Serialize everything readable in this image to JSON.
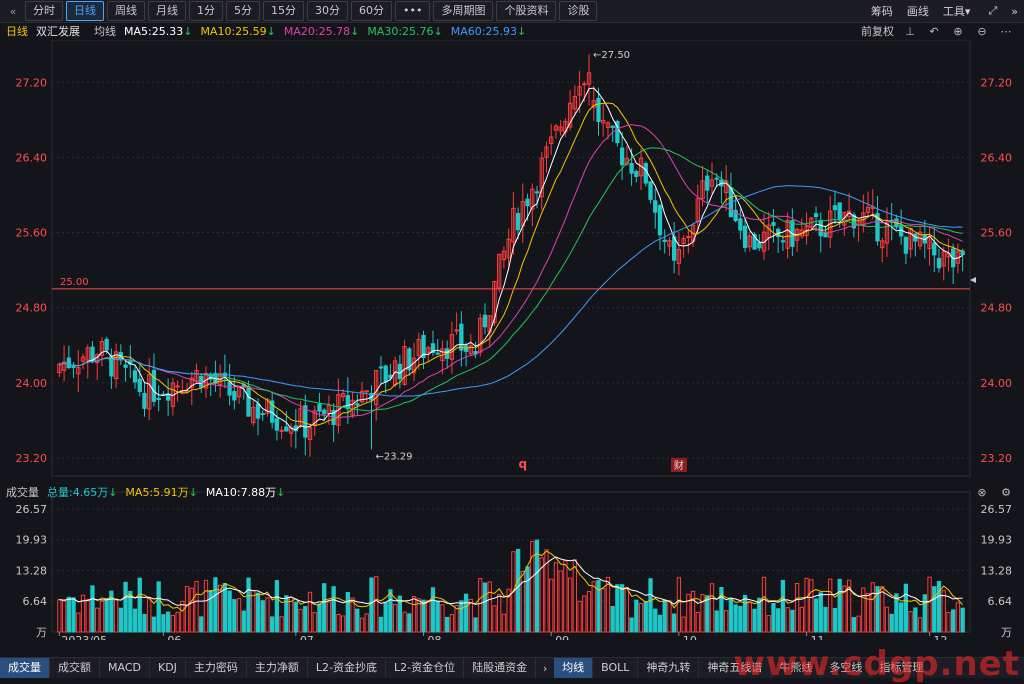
{
  "top_tabs": [
    "分时",
    "日线",
    "周线",
    "月线",
    "1分",
    "5分",
    "15分",
    "30分",
    "60分",
    "•••",
    "多周期图",
    "个股资料",
    "诊股"
  ],
  "active_tab": "日线",
  "top_right": [
    "筹码",
    "画线",
    "工具▾"
  ],
  "info": {
    "period": "日线",
    "name": "双汇发展",
    "indicator": "均线",
    "ma5": "MA5:25.33",
    "ma10": "MA10:25.59",
    "ma20": "MA20:25.78",
    "ma30": "MA30:25.76",
    "ma60": "MA60:25.93",
    "adjust": "前复权"
  },
  "colors": {
    "up": "#ff3b3b",
    "down": "#1fc7c7",
    "ma5": "#ffffff",
    "ma10": "#f5c400",
    "ma20": "#e040b0",
    "ma30": "#22c55e",
    "ma60": "#3b9cff",
    "bg": "#14151b",
    "grid": "#2b2c33"
  },
  "price_axis": [
    "27.20",
    "26.40",
    "25.60",
    "24.80",
    "24.00",
    "23.20"
  ],
  "annotations": {
    "high": "27.50",
    "low": "23.29",
    "hline": "25.00",
    "marker_q": "q",
    "marker_cai": "财"
  },
  "volume_info": {
    "label": "成交量",
    "total": "总量:4.65万",
    "ma5": "MA5:5.91万",
    "ma10": "MA10:7.88万"
  },
  "volume_axis": [
    "26.57",
    "19.93",
    "13.28",
    "6.64",
    "万"
  ],
  "date_axis": [
    "2023/05",
    "06",
    "07",
    "08",
    "09",
    "10",
    "11",
    "12"
  ],
  "bottom_tabs": [
    "成交量",
    "成交额",
    "MACD",
    "KDJ",
    "主力密码",
    "主力净额",
    "L2-资金抄底",
    "L2-资金仓位",
    "陆股通资金"
  ],
  "bottom_tabs_right": [
    "均线",
    "BOLL",
    "神奇九转",
    "神奇五线谱",
    "牛熊线",
    "多空线",
    "指标管理"
  ],
  "watermark": "www.cdgp.net"
}
